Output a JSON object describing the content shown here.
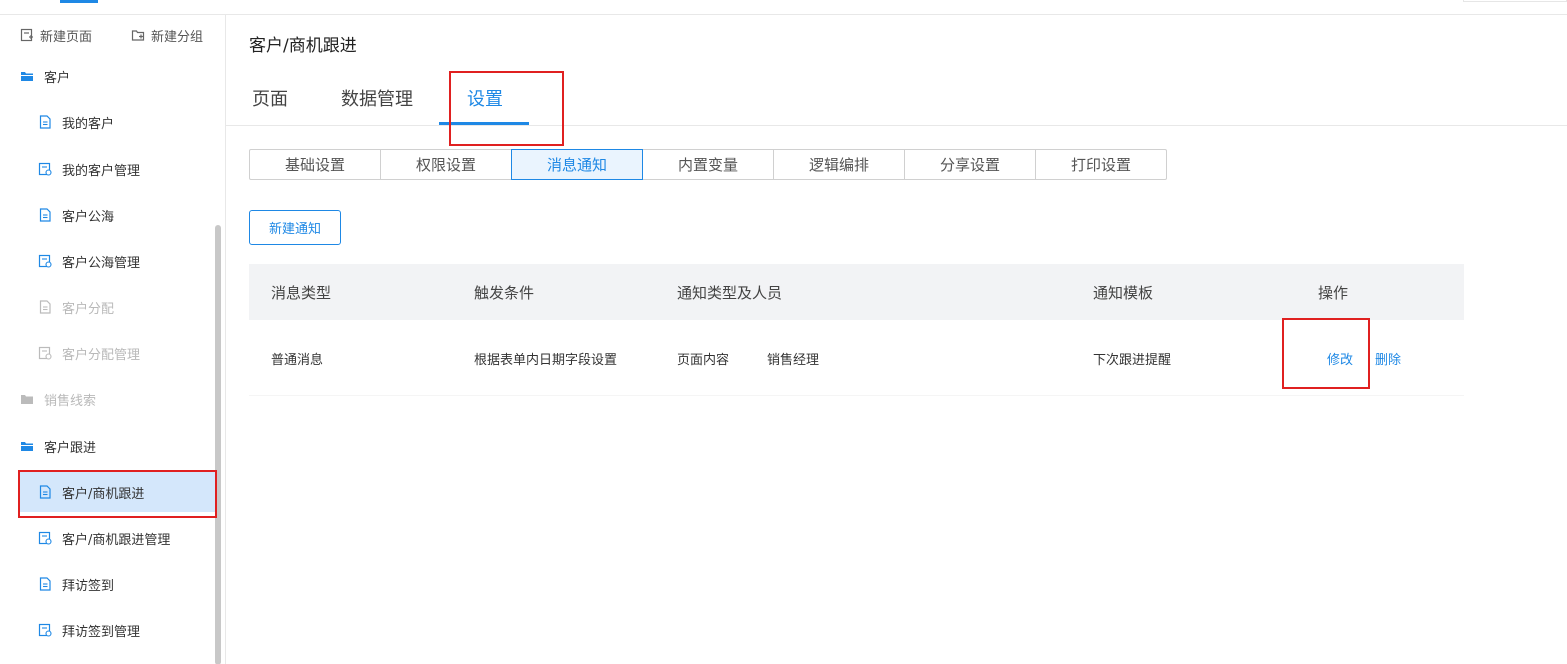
{
  "sidebar": {
    "actions": [
      {
        "label": "新建页面",
        "icon": "new-page-icon"
      },
      {
        "label": "新建分组",
        "icon": "new-group-icon"
      }
    ],
    "rows": [
      {
        "label": "客户",
        "kind": "group",
        "icon": "folder-open-icon"
      },
      {
        "label": "我的客户",
        "kind": "item",
        "icon": "document-icon"
      },
      {
        "label": "我的客户管理",
        "kind": "item",
        "icon": "form-manage-icon"
      },
      {
        "label": "客户公海",
        "kind": "item",
        "icon": "document-icon"
      },
      {
        "label": "客户公海管理",
        "kind": "item",
        "icon": "form-manage-icon"
      },
      {
        "label": "客户分配",
        "kind": "item",
        "icon": "document-icon",
        "disabled": true
      },
      {
        "label": "客户分配管理",
        "kind": "item",
        "icon": "form-manage-icon",
        "disabled": true
      },
      {
        "label": "销售线索",
        "kind": "group",
        "icon": "folder-closed-icon",
        "disabled": true
      },
      {
        "label": "客户跟进",
        "kind": "group",
        "icon": "folder-open-icon"
      },
      {
        "label": "客户/商机跟进",
        "kind": "item",
        "icon": "document-icon",
        "selected": true
      },
      {
        "label": "客户/商机跟进管理",
        "kind": "item",
        "icon": "form-manage-icon"
      },
      {
        "label": "拜访签到",
        "kind": "item",
        "icon": "document-icon"
      },
      {
        "label": "拜访签到管理",
        "kind": "item",
        "icon": "form-manage-icon"
      }
    ]
  },
  "page": {
    "title": "客户/商机跟进"
  },
  "main_tabs": [
    {
      "label": "页面"
    },
    {
      "label": "数据管理"
    },
    {
      "label": "设置",
      "active": true
    }
  ],
  "settings_tabs": [
    {
      "label": "基础设置"
    },
    {
      "label": "权限设置"
    },
    {
      "label": "消息通知",
      "active": true
    },
    {
      "label": "内置变量"
    },
    {
      "label": "逻辑编排"
    },
    {
      "label": "分享设置"
    },
    {
      "label": "打印设置"
    }
  ],
  "new_notification_label": "新建通知",
  "table": {
    "headers": [
      "消息类型",
      "触发条件",
      "通知类型及人员",
      "通知模板",
      "操作"
    ],
    "rows": [
      {
        "type": "普通消息",
        "trigger": "根据表单内日期字段设置",
        "notify_type": "页面内容",
        "notify_person": "销售经理",
        "template": "下次跟进提醒",
        "edit": "修改",
        "delete": "删除"
      }
    ]
  },
  "colors": {
    "accent": "#1e88e5",
    "selected_bg": "#d4e7fb",
    "annotation_red": "#e02020",
    "header_bg": "#f2f3f5"
  }
}
